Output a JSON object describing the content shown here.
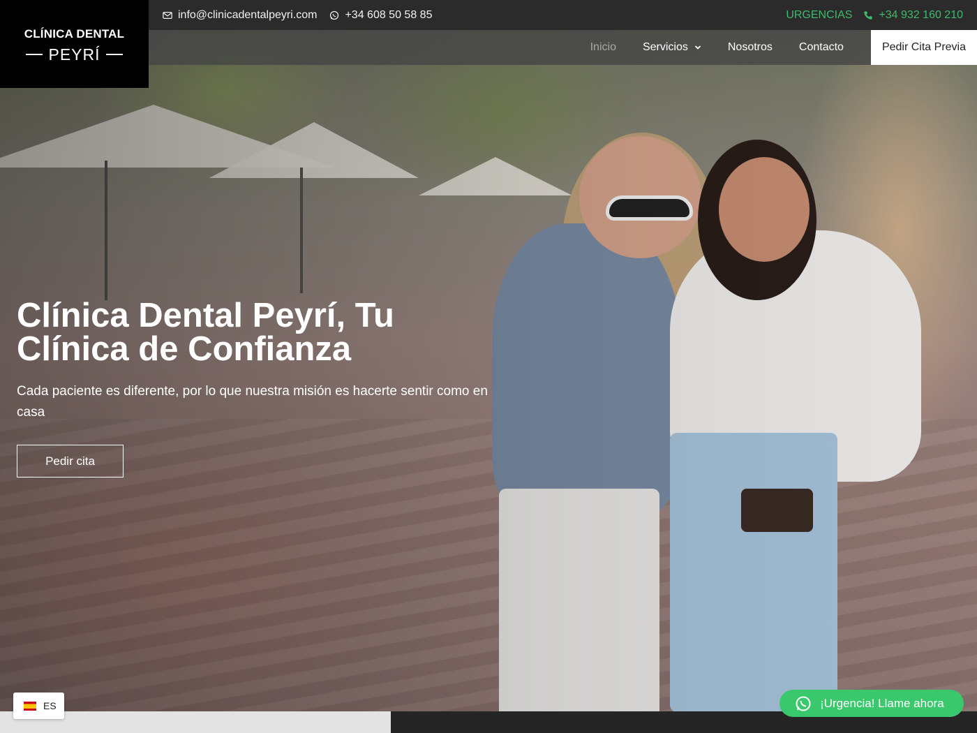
{
  "brand": {
    "line1": "CLÍNICA DENTAL",
    "line2": "PEYRÍ"
  },
  "topbar": {
    "email": "info@clinicadentalpeyri.com",
    "whatsapp": "+34 608 50 58 85",
    "urgencias_label": "URGENCIAS",
    "urgencias_phone": "+34 932 160 210",
    "icons": {
      "email": "envelope-icon",
      "whatsapp": "whatsapp-icon",
      "phone": "phone-icon"
    },
    "accent_color": "#3dba6b"
  },
  "nav": {
    "items": [
      {
        "label": "Inicio",
        "active": true
      },
      {
        "label": "Servicios",
        "has_dropdown": true
      },
      {
        "label": "Nosotros"
      },
      {
        "label": "Contacto"
      }
    ],
    "cta": "Pedir Cita Previa"
  },
  "hero": {
    "title": "Clínica Dental Peyrí, Tu Clínica de Confianza",
    "subtitle": "Cada paciente es diferente, por lo que nuestra misión es hacerte sentir como en casa",
    "button": "Pedir cita"
  },
  "language": {
    "code": "ES",
    "flag": "spain-flag-icon"
  },
  "whatsapp_button": {
    "label": "¡Urgencia! Llame ahora",
    "icon": "whatsapp-icon",
    "color": "#3ac86c"
  }
}
